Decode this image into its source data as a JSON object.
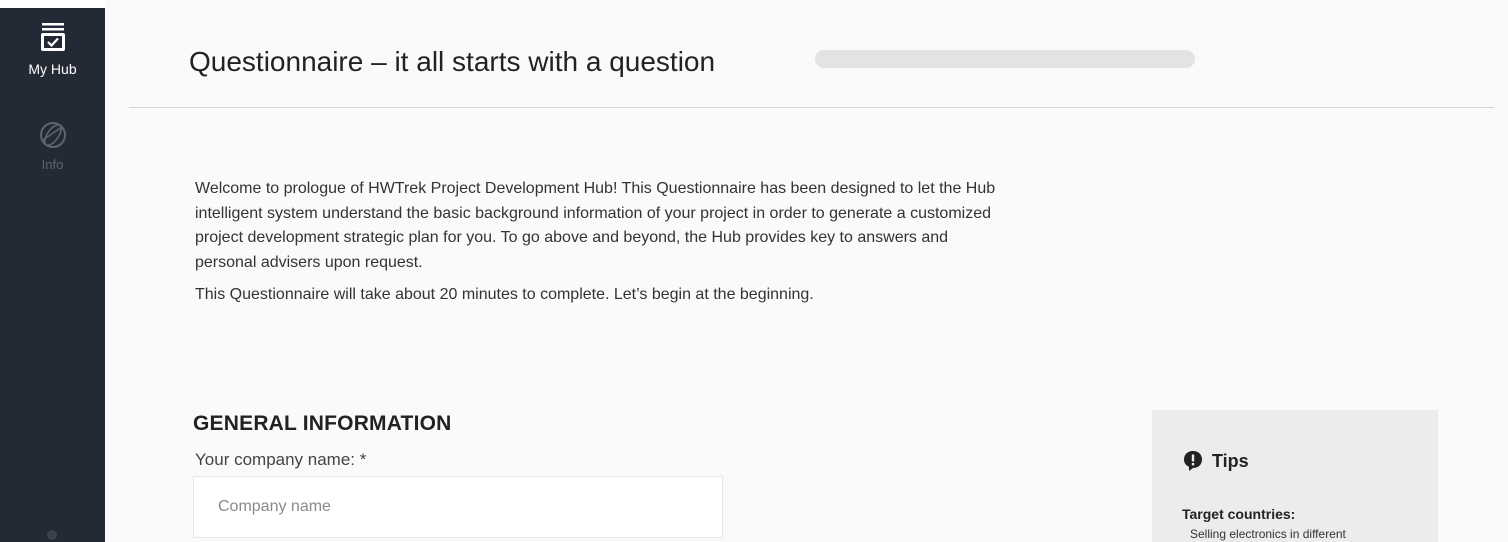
{
  "sidebar": {
    "items": [
      {
        "label": "My Hub",
        "icon": "inbox-check-icon",
        "active": true
      },
      {
        "label": "Info",
        "icon": "globe-icon",
        "active": false
      }
    ]
  },
  "header": {
    "title": "Questionnaire – it all starts with a question",
    "progress": 0
  },
  "intro": {
    "paragraph_1": "Welcome to prologue of HWTrek Project Development Hub! This Questionnaire has been designed to let the Hub intelligent system understand the basic background information of your project in order to generate a customized project development strategic plan for you. To go above and beyond, the Hub provides key to answers and personal advisers upon request.",
    "paragraph_2": "This Questionnaire will take about 20 minutes to complete. Let’s begin at the beginning."
  },
  "form": {
    "section_title": "GENERAL INFORMATION",
    "company_label": "Your company name: *",
    "company_placeholder": "Company name",
    "company_value": ""
  },
  "tips": {
    "icon": "exclamation-bubble-icon",
    "title": "Tips",
    "subtitle": "Target countries:",
    "body": "Selling electronics in different"
  },
  "colors": {
    "sidebar_bg": "#232a35",
    "sidebar_label": "#ffffff",
    "inactive_label": "#5b6572",
    "tips_bg": "#ececec"
  }
}
